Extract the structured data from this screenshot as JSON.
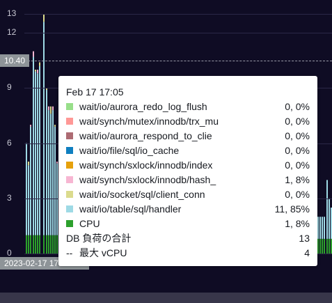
{
  "chart_data": {
    "type": "bar",
    "y_ticks": [
      "0",
      "3",
      "6",
      "9",
      "12",
      "13"
    ],
    "crosshair_value": "10.40",
    "time_axis_label": "2023-02-17 17:05",
    "colors": {
      "cpu": "#2ca02c",
      "handler": "#9edae5",
      "client_conn": "#dbdb8d",
      "hash": "#f7b6d2",
      "index": "#e6a10c"
    }
  },
  "tooltip": {
    "title": "Feb 17 17:05",
    "rows": [
      {
        "name": "wait/io/aurora_redo_log_flush",
        "value": "0, 0%",
        "color": "#98df8a"
      },
      {
        "name": "wait/synch/mutex/innodb/trx_mu",
        "value": "0, 0%",
        "color": "#ff9896"
      },
      {
        "name": "wait/io/aurora_respond_to_clie",
        "value": "0, 0%",
        "color": "#ad6b73"
      },
      {
        "name": "wait/io/file/sql/io_cache",
        "value": "0, 0%",
        "color": "#0f7fc0"
      },
      {
        "name": "wait/synch/sxlock/innodb/index",
        "value": "0, 0%",
        "color": "#e6a10c"
      },
      {
        "name": "wait/synch/sxlock/innodb/hash_",
        "value": "1, 8%",
        "color": "#f7b6d2"
      },
      {
        "name": "wait/io/socket/sql/client_conn",
        "value": "0, 0%",
        "color": "#dbdb8d"
      },
      {
        "name": "wait/io/table/sql/handler",
        "value": "11, 85%",
        "color": "#9edae5"
      },
      {
        "name": "CPU",
        "value": "1, 8%",
        "color": "#2ca02c"
      }
    ],
    "total_label": "DB 負荷の合計",
    "total_value": "13",
    "max_vcpu_dash": "--",
    "max_vcpu_label": "最大 vCPU",
    "max_vcpu_value": "4"
  }
}
